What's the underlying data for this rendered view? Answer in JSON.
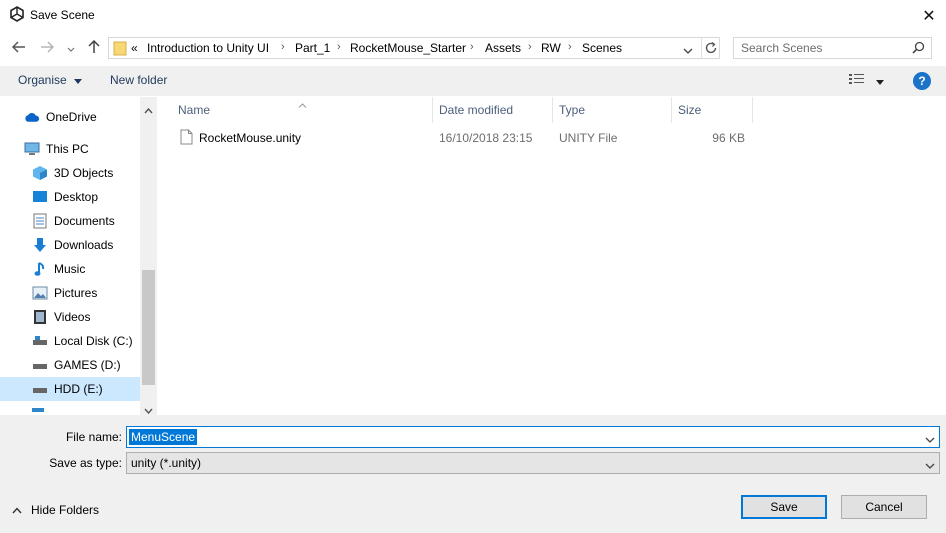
{
  "window": {
    "title": "Save Scene",
    "icon": "unity-logo-icon"
  },
  "nav": {
    "breadcrumbs": [
      "«",
      "Introduction to Unity UI",
      "Part_1",
      "RocketMouse_Starter",
      "Assets",
      "RW",
      "Scenes"
    ],
    "search_placeholder": "Search Scenes"
  },
  "toolbar": {
    "organise_label": "Organise",
    "new_folder_label": "New folder"
  },
  "sidebar": {
    "items": [
      {
        "label": "OneDrive",
        "icon": "cloud-icon"
      },
      {
        "label": "This PC",
        "icon": "computer-icon"
      },
      {
        "label": "3D Objects",
        "icon": "cube-icon"
      },
      {
        "label": "Desktop",
        "icon": "desktop-icon"
      },
      {
        "label": "Documents",
        "icon": "document-icon"
      },
      {
        "label": "Downloads",
        "icon": "download-icon"
      },
      {
        "label": "Music",
        "icon": "music-icon"
      },
      {
        "label": "Pictures",
        "icon": "pictures-icon"
      },
      {
        "label": "Videos",
        "icon": "video-icon"
      },
      {
        "label": "Local Disk (C:)",
        "icon": "drive-icon"
      },
      {
        "label": "GAMES (D:)",
        "icon": "drive-icon"
      },
      {
        "label": "HDD (E:)",
        "icon": "drive-icon"
      }
    ],
    "selected": "HDD (E:)"
  },
  "file_list": {
    "columns": [
      "Name",
      "Date modified",
      "Type",
      "Size"
    ],
    "rows": [
      {
        "name": "RocketMouse.unity",
        "date_modified": "16/10/2018 23:15",
        "type": "UNITY File",
        "size": "96 KB"
      }
    ]
  },
  "form": {
    "file_name_label": "File name:",
    "file_name_value": "MenuScene",
    "save_type_label": "Save as type:",
    "save_type_value": "unity (*.unity)"
  },
  "footer": {
    "hide_folders_label": "Hide Folders",
    "save_label": "Save",
    "cancel_label": "Cancel"
  },
  "colors": {
    "accent": "#0078d7",
    "help": "#1a73c9",
    "selection": "#cce8ff",
    "column_header_text": "#4c607a",
    "panel_bg": "#f0f0f0"
  }
}
